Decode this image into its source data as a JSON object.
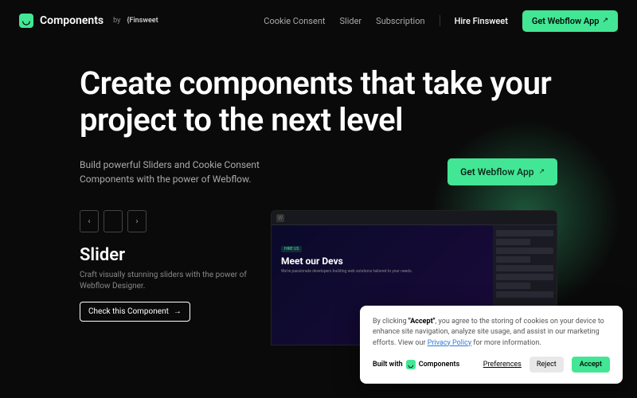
{
  "nav": {
    "logo": "Components",
    "by": "by",
    "brand": "{Finsweet",
    "links": [
      "Cookie Consent",
      "Slider",
      "Subscription"
    ],
    "hire": "Hire Finsweet",
    "cta": "Get Webflow App"
  },
  "hero": {
    "title": "Create components that take your project to the next level",
    "desc": "Build powerful Sliders and Cookie Consent Components with the power of Webflow.",
    "cta": "Get Webflow App"
  },
  "slider": {
    "title": "Slider",
    "desc": "Craft visually stunning sliders with the power of Webflow Designer.",
    "cta": "Check this Component"
  },
  "preview": {
    "badge": "HIRE US",
    "title": "Meet our Devs",
    "sub": "We're passionate developers building web solutions tailored to your needs."
  },
  "cookie": {
    "text_prefix": "By clicking ",
    "accept_word": "\"Accept\"",
    "text_mid": ", you agree to the storing of cookies on your device to enhance site navigation, analyze site usage, and assist in our marketing efforts. View our ",
    "policy": "Privacy Policy",
    "text_suffix": " for more information.",
    "built_with": "Built with",
    "built_brand": "Components",
    "prefs": "Preferences",
    "reject": "Reject",
    "accept": "Accept"
  }
}
